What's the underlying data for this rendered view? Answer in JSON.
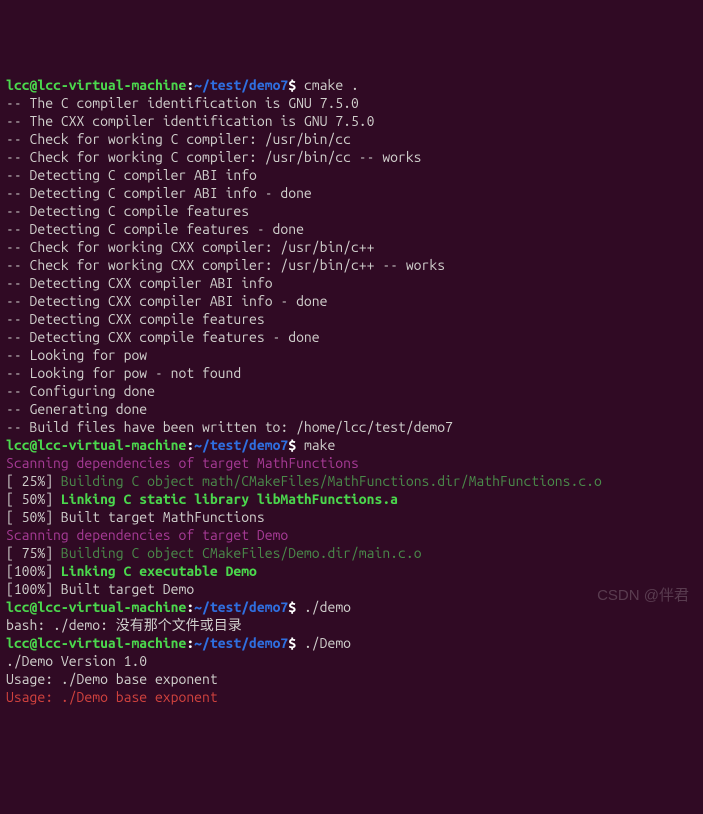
{
  "prompt": {
    "user": "lcc",
    "host": "lcc-virtual-machine",
    "sep1": "@",
    "sep2": ":",
    "path": "~/test/demo7",
    "suffix": "$ "
  },
  "cmd": {
    "cmake": "cmake .",
    "make": "make",
    "run1": "./demo",
    "run2": "./Demo"
  },
  "cmake_out": [
    "-- The C compiler identification is GNU 7.5.0",
    "-- The CXX compiler identification is GNU 7.5.0",
    "-- Check for working C compiler: /usr/bin/cc",
    "-- Check for working C compiler: /usr/bin/cc -- works",
    "-- Detecting C compiler ABI info",
    "-- Detecting C compiler ABI info - done",
    "-- Detecting C compile features",
    "-- Detecting C compile features - done",
    "-- Check for working CXX compiler: /usr/bin/c++",
    "-- Check for working CXX compiler: /usr/bin/c++ -- works",
    "-- Detecting CXX compiler ABI info",
    "-- Detecting CXX compiler ABI info - done",
    "-- Detecting CXX compile features",
    "-- Detecting CXX compile features - done",
    "-- Looking for pow",
    "-- Looking for pow - not found",
    "-- Configuring done",
    "-- Generating done",
    "-- Build files have been written to: /home/lcc/test/demo7"
  ],
  "make_out": {
    "scan1": "Scanning dependencies of target MathFunctions",
    "l1_pct": "[ 25%] ",
    "l1_txt": "Building C object math/CMakeFiles/MathFunctions.dir/MathFunctions.c.o",
    "l2_pct": "[ 50%] ",
    "l2_txt": "Linking C static library libMathFunctions.a",
    "l3": "[ 50%] Built target MathFunctions",
    "scan2": "Scanning dependencies of target Demo",
    "l4_pct": "[ 75%] ",
    "l4_txt": "Building C object CMakeFiles/Demo.dir/main.c.o",
    "l5_pct": "[100%] ",
    "l5_txt": "Linking C executable Demo",
    "l6": "[100%] Built target Demo"
  },
  "bash_err": "bash: ./demo: 没有那个文件或目录",
  "demo_out": [
    "./Demo Version 1.0",
    "Usage: ./Demo base exponent",
    "Usage: ./Demo base exponent"
  ],
  "watermark": "CSDN @伴君"
}
